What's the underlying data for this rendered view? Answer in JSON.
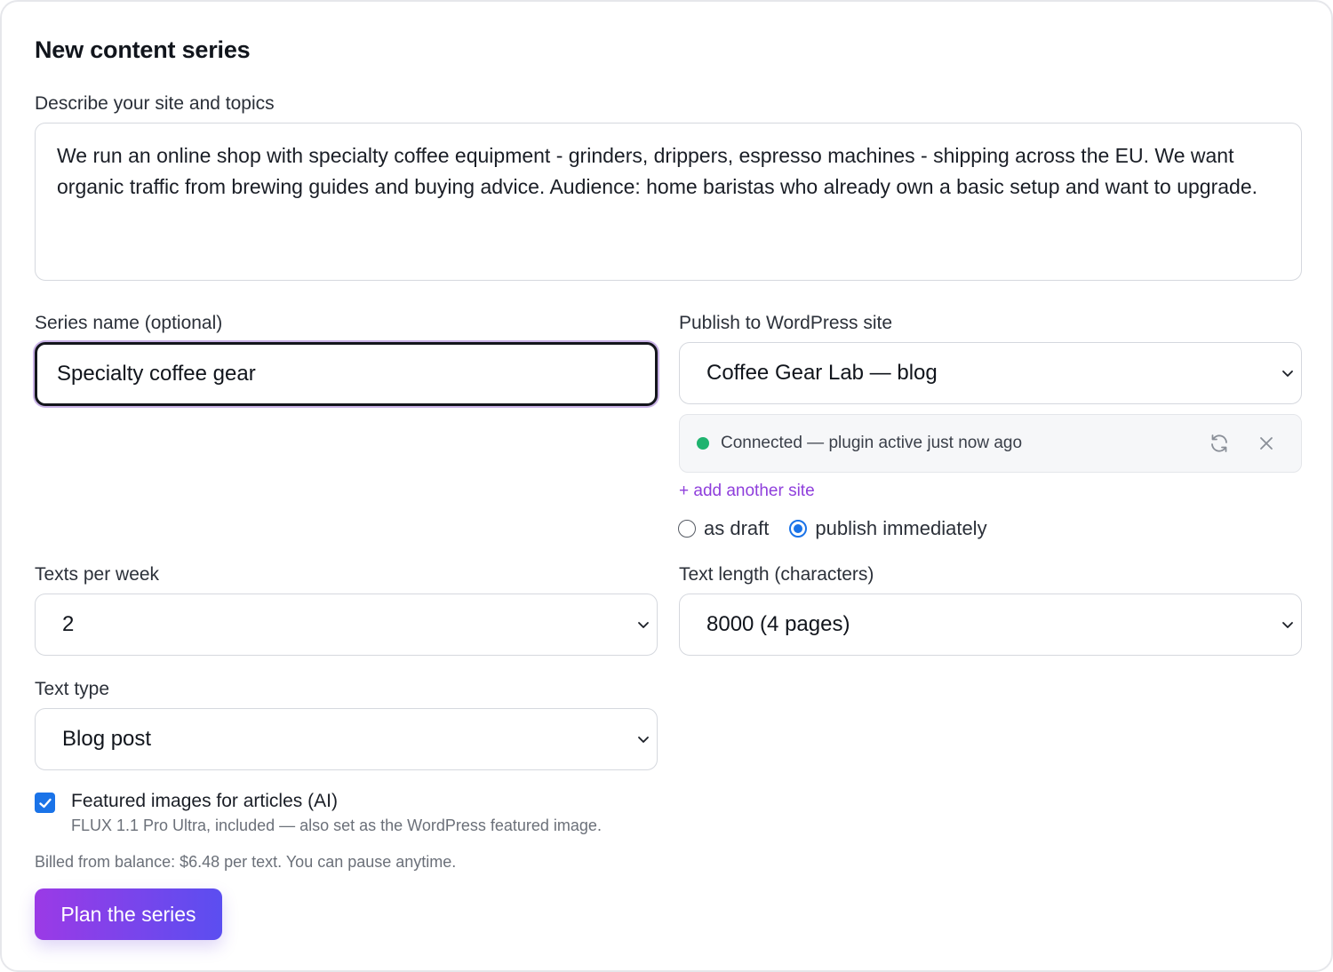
{
  "form": {
    "title": "New content series",
    "description": {
      "label": "Describe your site and topics",
      "value": "We run an online shop with specialty coffee equipment - grinders, drippers, espresso machines - shipping across the EU. We want organic traffic from brewing guides and buying advice. Audience: home baristas who already own a basic setup and want to upgrade."
    },
    "series_name": {
      "label": "Series name (optional)",
      "value": "Specialty coffee gear"
    },
    "wordpress": {
      "label": "Publish to WordPress site",
      "selected": "Coffee Gear Lab — blog",
      "status_text": "Connected — plugin active just now ago",
      "status_color": "#1fb36f",
      "refresh_icon": "refresh-icon",
      "remove_icon": "close-icon",
      "add_site_link": "+ add another site",
      "publish_options": [
        {
          "label": "as draft",
          "checked": false
        },
        {
          "label": "publish immediately",
          "checked": true
        }
      ]
    },
    "texts_per_week": {
      "label": "Texts per week",
      "selected": "2"
    },
    "text_length": {
      "label": "Text length (characters)",
      "selected": "8000 (4 pages)"
    },
    "text_type": {
      "label": "Text type",
      "selected": "Blog post"
    },
    "featured_images": {
      "checked": true,
      "label": "Featured images for articles (AI)",
      "help": "FLUX 1.1 Pro Ultra, included — also set as the WordPress featured image."
    },
    "billing_note": "Billed from balance: $6.48 per text. You can pause anytime.",
    "submit_label": "Plan the series"
  },
  "colors": {
    "accent_gradient_start": "#9b3ae6",
    "accent_gradient_end": "#5b4ef0",
    "link": "#8f3fdc",
    "check_blue": "#1a73e8"
  }
}
